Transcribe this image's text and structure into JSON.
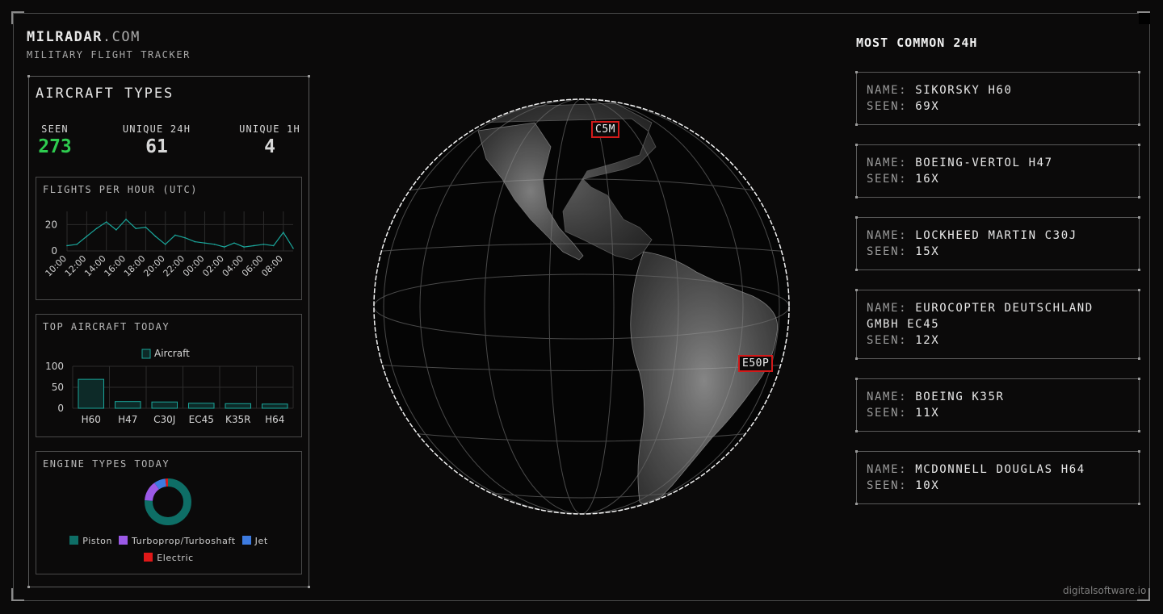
{
  "brand": {
    "name": "MILRADAR",
    "tld": ".COM",
    "subtitle": "MILITARY FLIGHT TRACKER"
  },
  "aircraft_types": {
    "title": "AIRCRAFT TYPES",
    "stats": [
      {
        "label": "SEEN",
        "value": "273",
        "color": "#2ecc4f"
      },
      {
        "label": "UNIQUE 24H",
        "value": "61"
      },
      {
        "label": "UNIQUE 1H",
        "value": "4"
      }
    ]
  },
  "flights_per_hour": {
    "title": "FLIGHTS PER HOUR (UTC)",
    "chart_data": {
      "type": "line",
      "x": [
        "10:00",
        "11:00",
        "12:00",
        "13:00",
        "14:00",
        "15:00",
        "16:00",
        "17:00",
        "18:00",
        "19:00",
        "20:00",
        "21:00",
        "22:00",
        "23:00",
        "00:00",
        "01:00",
        "02:00",
        "03:00",
        "04:00",
        "05:00",
        "06:00",
        "07:00",
        "08:00",
        "09:00"
      ],
      "series": [
        {
          "values": [
            4,
            5,
            11,
            17,
            22,
            16,
            24,
            17,
            18,
            11,
            5,
            12,
            10,
            7,
            6,
            5,
            3,
            6,
            3,
            4,
            5,
            4,
            14,
            2
          ]
        }
      ],
      "x_tick_labels": [
        "10:00",
        "12:00",
        "14:00",
        "16:00",
        "18:00",
        "20:00",
        "22:00",
        "00:00",
        "02:00",
        "04:00",
        "06:00",
        "08:00"
      ],
      "y_ticks": [
        0,
        20
      ],
      "ylim": [
        0,
        30
      ],
      "grid": true,
      "color": "#1aa59a"
    }
  },
  "top_aircraft": {
    "title": "TOP AIRCRAFT TODAY",
    "chart_data": {
      "type": "bar",
      "categories": [
        "H60",
        "H47",
        "C30J",
        "EC45",
        "K35R",
        "H64"
      ],
      "series": [
        {
          "name": "Aircraft",
          "values": [
            69,
            16,
            15,
            12,
            11,
            10
          ]
        }
      ],
      "y_ticks": [
        0,
        50,
        100
      ],
      "ylim": [
        0,
        100
      ],
      "legend": "top-center",
      "grid": true,
      "color": "#1aa59a"
    }
  },
  "engine_types": {
    "title": "ENGINE TYPES TODAY",
    "chart_data": {
      "type": "pie",
      "categories": [
        "Piston",
        "Turboprop/Turboshaft",
        "Jet",
        "Electric"
      ],
      "values": [
        76,
        14,
        8,
        2
      ],
      "colors": [
        "#0e6e66",
        "#9b59e6",
        "#3d7be0",
        "#e01818"
      ],
      "legend": "bottom"
    }
  },
  "globe": {
    "tags": [
      {
        "label": "C5M"
      },
      {
        "label": "E50P"
      }
    ]
  },
  "most_common": {
    "title": "MOST COMMON 24H",
    "name_key": "NAME:",
    "seen_key": "SEEN:",
    "items": [
      {
        "name": "SIKORSKY H60",
        "seen": "69X"
      },
      {
        "name": "BOEING-VERTOL H47",
        "seen": "16X"
      },
      {
        "name": "LOCKHEED MARTIN C30J",
        "seen": "15X"
      },
      {
        "name": "EUROCOPTER DEUTSCHLAND GMBH EC45",
        "seen": "12X"
      },
      {
        "name": "BOEING K35R",
        "seen": "11X"
      },
      {
        "name": "MCDONNELL DOUGLAS H64",
        "seen": "10X"
      }
    ]
  },
  "footer": "digitalsoftware.io"
}
